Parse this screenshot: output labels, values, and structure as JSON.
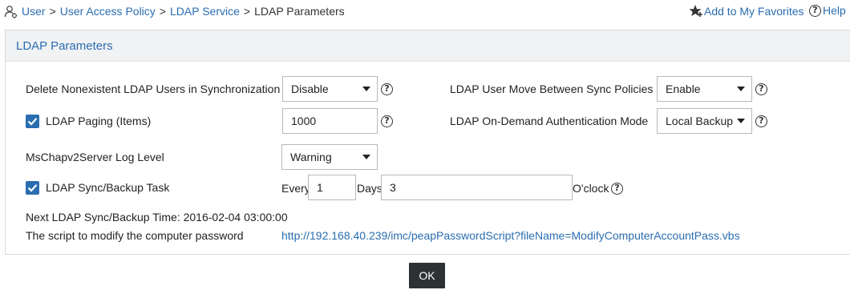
{
  "breadcrumb": {
    "items": [
      "User",
      "User Access Policy",
      "LDAP Service",
      "LDAP Parameters"
    ],
    "separator": ">"
  },
  "header": {
    "favorites_label": "Add to My Favorites",
    "help_label": "Help"
  },
  "panel": {
    "title": "LDAP Parameters"
  },
  "form": {
    "delete_nonexistent": {
      "label": "Delete Nonexistent LDAP Users in Synchronization",
      "value": "Disable"
    },
    "paging": {
      "label": "LDAP Paging (Items)",
      "checked": true,
      "value": "1000"
    },
    "mschap_log": {
      "label": "MsChapv2Server Log Level",
      "value": "Warning"
    },
    "sync_task": {
      "label": "LDAP Sync/Backup Task",
      "checked": true,
      "every_label": "Every",
      "every_value": "1",
      "days_label": "Days",
      "days_value": "3",
      "oclock_label": "O'clock"
    },
    "next_sync": {
      "label": "Next LDAP Sync/Backup Time: 2016-02-04 03:00:00"
    },
    "script": {
      "label": "The script to modify the computer password",
      "url": "http://192.168.40.239/imc/peapPasswordScript?fileName=ModifyComputerAccountPass.vbs"
    },
    "move_between": {
      "label": "LDAP User Move Between Sync Policies",
      "value": "Enable"
    },
    "on_demand": {
      "label": "LDAP On-Demand Authentication Mode",
      "value": "Local Backup"
    }
  },
  "help_glyph": "?",
  "ok_label": "OK",
  "colors": {
    "link": "#2a6db0",
    "checkbox": "#2a6db0",
    "ok_button": "#2d3134",
    "panel_header": "#f1f2f4"
  },
  "icons": {
    "breadcrumb": "user-admin-icon",
    "favorites": "star-add-icon",
    "help": "question-circle-icon"
  }
}
